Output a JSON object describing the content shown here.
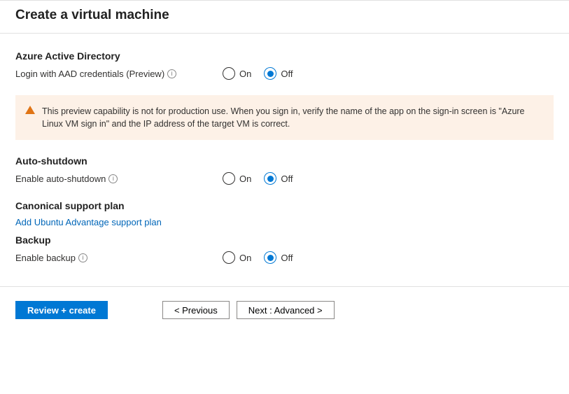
{
  "page": {
    "title": "Create a virtual machine"
  },
  "aad": {
    "heading": "Azure Active Directory",
    "field_label": "Login with AAD credentials (Preview)",
    "on": "On",
    "off": "Off",
    "selected": "off"
  },
  "alert": {
    "text": "This preview capability is not for production use.  When you sign in, verify the name of the app on the sign-in screen is \"Azure Linux VM sign in\" and the IP address of the target VM is correct."
  },
  "autoshutdown": {
    "heading": "Auto-shutdown",
    "field_label": "Enable auto-shutdown",
    "on": "On",
    "off": "Off",
    "selected": "off"
  },
  "canonical": {
    "heading": "Canonical support plan",
    "link": "Add Ubuntu Advantage support plan"
  },
  "backup": {
    "heading": "Backup",
    "field_label": "Enable backup",
    "on": "On",
    "off": "Off",
    "selected": "off"
  },
  "footer": {
    "review": "Review + create",
    "prev": "< Previous",
    "next": "Next : Advanced >"
  }
}
